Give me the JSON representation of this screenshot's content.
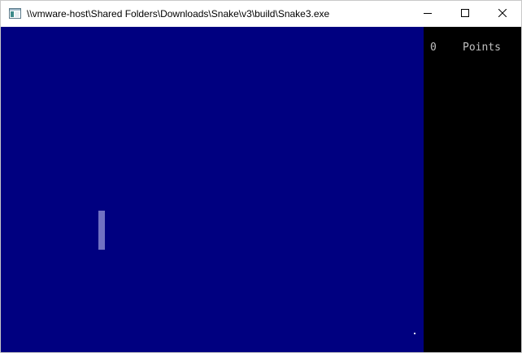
{
  "window": {
    "title": "\\\\vmware-host\\Shared Folders\\Downloads\\Snake\\v3\\build\\Snake3.exe",
    "app_icon": "console-window-icon",
    "buttons": {
      "minimize": "minimize-icon",
      "maximize": "maximize-icon",
      "close": "close-icon"
    }
  },
  "game": {
    "score_value": "0",
    "score_label": "Points",
    "colors": {
      "playfield": "#000080",
      "sidebar": "#000000",
      "text": "#c0c0c0",
      "snake": "#d8d8ff"
    }
  }
}
